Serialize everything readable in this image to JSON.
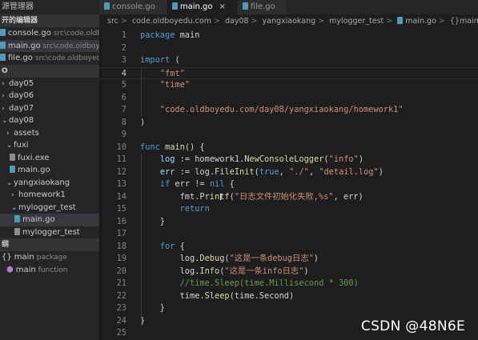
{
  "sidebar": {
    "title": "源管理器",
    "open_editors_header": "开的编辑器",
    "open_editors": [
      {
        "name": "console.go",
        "path": "src\\code.oldb..."
      },
      {
        "name": "main.go",
        "path": "src\\code.oldboye..."
      },
      {
        "name": "file.go",
        "path": "src\\code.oldboyedu..."
      }
    ],
    "folder_header": "O",
    "tree": [
      {
        "label": "day05",
        "expanded": false
      },
      {
        "label": "day06",
        "expanded": false
      },
      {
        "label": "day07",
        "expanded": false
      },
      {
        "label": "day08",
        "expanded": true
      },
      {
        "label": "assets",
        "expanded": false
      },
      {
        "label": "fuxi",
        "expanded": true
      },
      {
        "label": "fuxi.exe"
      },
      {
        "label": "main.go"
      },
      {
        "label": "yangxiaokang",
        "expanded": true
      },
      {
        "label": "homework1",
        "expanded": false
      },
      {
        "label": "mylogger_test",
        "expanded": true
      },
      {
        "label": "main.go"
      },
      {
        "label": "mylogger_test"
      }
    ],
    "outline_header": "纲",
    "outline": [
      {
        "icon": "{}",
        "name": "main",
        "kind": "package"
      },
      {
        "icon": "⬢",
        "name": "main",
        "kind": "function"
      }
    ]
  },
  "tabs": [
    {
      "label": "console.go",
      "active": false
    },
    {
      "label": "main.go",
      "active": true,
      "close": "×"
    },
    {
      "label": "file.go",
      "active": false
    }
  ],
  "breadcrumb": [
    "src",
    "code.oldboyedu.com",
    "day08",
    "yangxiaokang",
    "mylogger_test",
    "main.go",
    "{}main"
  ],
  "breadcrumb_sep": ">",
  "editor": {
    "current_line": 4,
    "lines": [
      {
        "n": "1",
        "tokens": [
          [
            "kw",
            "package"
          ],
          [
            "pl",
            " main"
          ]
        ]
      },
      {
        "n": "2",
        "tokens": []
      },
      {
        "n": "3",
        "tokens": [
          [
            "kw",
            "import"
          ],
          [
            "pl",
            " ("
          ]
        ]
      },
      {
        "n": "4",
        "tokens": [
          [
            "pl",
            "    "
          ],
          [
            "str",
            "\"fmt\""
          ]
        ]
      },
      {
        "n": "5",
        "tokens": [
          [
            "pl",
            "    "
          ],
          [
            "str",
            "\"time\""
          ]
        ]
      },
      {
        "n": "6",
        "tokens": []
      },
      {
        "n": "7",
        "tokens": [
          [
            "pl",
            "    "
          ],
          [
            "str",
            "\"code.oldboyedu.com/day08/yangxiaokang/homework1\""
          ]
        ]
      },
      {
        "n": "8",
        "tokens": [
          [
            "pl",
            ")"
          ]
        ]
      },
      {
        "n": "9",
        "tokens": []
      },
      {
        "n": "10",
        "tokens": [
          [
            "kw",
            "func"
          ],
          [
            "pl",
            " "
          ],
          [
            "fn",
            "main"
          ],
          [
            "pl",
            "() {"
          ]
        ]
      },
      {
        "n": "11",
        "tokens": [
          [
            "pl",
            "    "
          ],
          [
            "var",
            "log"
          ],
          [
            "pl",
            " := homework1."
          ],
          [
            "fn",
            "NewConsoleLogger"
          ],
          [
            "pl",
            "("
          ],
          [
            "str",
            "\"info\""
          ],
          [
            "pl",
            ")"
          ]
        ]
      },
      {
        "n": "12",
        "tokens": [
          [
            "pl",
            "    "
          ],
          [
            "var",
            "err"
          ],
          [
            "pl",
            " := log."
          ],
          [
            "fn",
            "FileInit"
          ],
          [
            "pl",
            "("
          ],
          [
            "kw",
            "true"
          ],
          [
            "pl",
            ", "
          ],
          [
            "str",
            "\"./\""
          ],
          [
            "pl",
            ", "
          ],
          [
            "str",
            "\"detail.log\""
          ],
          [
            "pl",
            ")"
          ]
        ]
      },
      {
        "n": "13",
        "tokens": [
          [
            "pl",
            "    "
          ],
          [
            "kw",
            "if"
          ],
          [
            "pl",
            " err != "
          ],
          [
            "kw",
            "nil"
          ],
          [
            "pl",
            " {"
          ]
        ]
      },
      {
        "n": "14",
        "tokens": [
          [
            "pl",
            "        fmt."
          ],
          [
            "fn",
            "Printf"
          ],
          [
            "pl",
            "("
          ],
          [
            "str",
            "\"日志文件初始化失败,%s\""
          ],
          [
            "pl",
            ", err)"
          ]
        ]
      },
      {
        "n": "15",
        "tokens": [
          [
            "pl",
            "        "
          ],
          [
            "kw",
            "return"
          ]
        ]
      },
      {
        "n": "16",
        "tokens": [
          [
            "pl",
            "    }"
          ]
        ]
      },
      {
        "n": "17",
        "tokens": []
      },
      {
        "n": "18",
        "tokens": [
          [
            "pl",
            "    "
          ],
          [
            "kw",
            "for"
          ],
          [
            "pl",
            " {"
          ]
        ]
      },
      {
        "n": "19",
        "tokens": [
          [
            "pl",
            "        log."
          ],
          [
            "fn",
            "Debug"
          ],
          [
            "pl",
            "("
          ],
          [
            "str",
            "\"这是一条debug日志\""
          ],
          [
            "pl",
            ")"
          ]
        ]
      },
      {
        "n": "20",
        "tokens": [
          [
            "pl",
            "        log."
          ],
          [
            "fn",
            "Info"
          ],
          [
            "pl",
            "("
          ],
          [
            "str",
            "\"这是一条info日志\""
          ],
          [
            "pl",
            ")"
          ]
        ]
      },
      {
        "n": "21",
        "tokens": [
          [
            "pl",
            "        "
          ],
          [
            "cm",
            "//time.Sleep(time.Millisecond * 300)"
          ]
        ]
      },
      {
        "n": "22",
        "tokens": [
          [
            "pl",
            "        time."
          ],
          [
            "fn",
            "Sleep"
          ],
          [
            "pl",
            "(time.Second)"
          ]
        ]
      },
      {
        "n": "23",
        "tokens": [
          [
            "pl",
            "    }"
          ]
        ]
      },
      {
        "n": "24",
        "tokens": [
          [
            "pl",
            "}"
          ]
        ]
      },
      {
        "n": "25",
        "tokens": []
      }
    ]
  },
  "watermark": "CSDN @48N6E",
  "colors": {
    "keyword": "#569cd6",
    "string": "#ce9178",
    "function": "#dcdcaa",
    "variable": "#9cdcfe",
    "comment": "#6a9955"
  }
}
